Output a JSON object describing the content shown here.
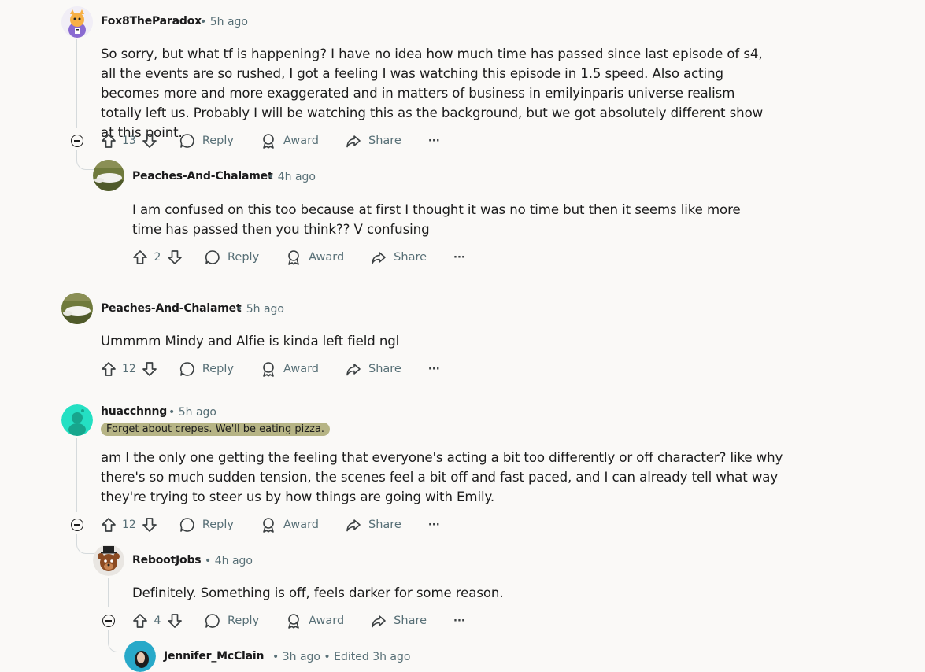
{
  "comments": [
    {
      "username": "Fox8TheParadox",
      "time": "• 5h ago",
      "text": "So sorry, but what tf is happening? I have no idea how much time has passed since last episode of s4, all the events are so rushed, I got a feeling I was watching this episode in 1.5 speed. Also acting becomes more and more exaggerated and in matters of business in emilyinparis universe realism totally left us. Probably I will be watching this as the background, but we got absolutely different show at this point.",
      "votes": "13"
    },
    {
      "username": "Peaches-And-Chalamet",
      "time": "• 4h ago",
      "text": "I am confused on this too because at first I thought it was no time but then it seems like more time has passed then you think?? V confusing",
      "votes": "2"
    },
    {
      "username": "Peaches-And-Chalamet",
      "time": "• 5h ago",
      "text": "Ummmm Mindy and Alfie is kinda left field ngl",
      "votes": "12"
    },
    {
      "username": "huacchnng",
      "time": "• 5h ago",
      "flair": "Forget about crepes. We'll be eating pizza.",
      "text": "am I the only one getting the feeling that everyone's acting a bit too differently or off character? like why there's so much sudden tension, the scenes feel a bit off and fast paced, and I can already tell what way they're trying to steer us by how things are going with Emily.",
      "votes": "12"
    },
    {
      "username": "RebootJobs",
      "time": "• 4h ago",
      "text": "Definitely. Something is off, feels darker for some reason.",
      "votes": "4"
    },
    {
      "username": "Jennifer_McClain",
      "time": "• 3h ago • Edited 3h ago"
    }
  ],
  "actions": {
    "reply": "Reply",
    "award": "Award",
    "share": "Share",
    "more": "···"
  },
  "colors": {
    "background": "#faf9f7",
    "meta": "#576f76",
    "thread_line": "#d5dadc",
    "flair_bg": "#b6b485"
  }
}
